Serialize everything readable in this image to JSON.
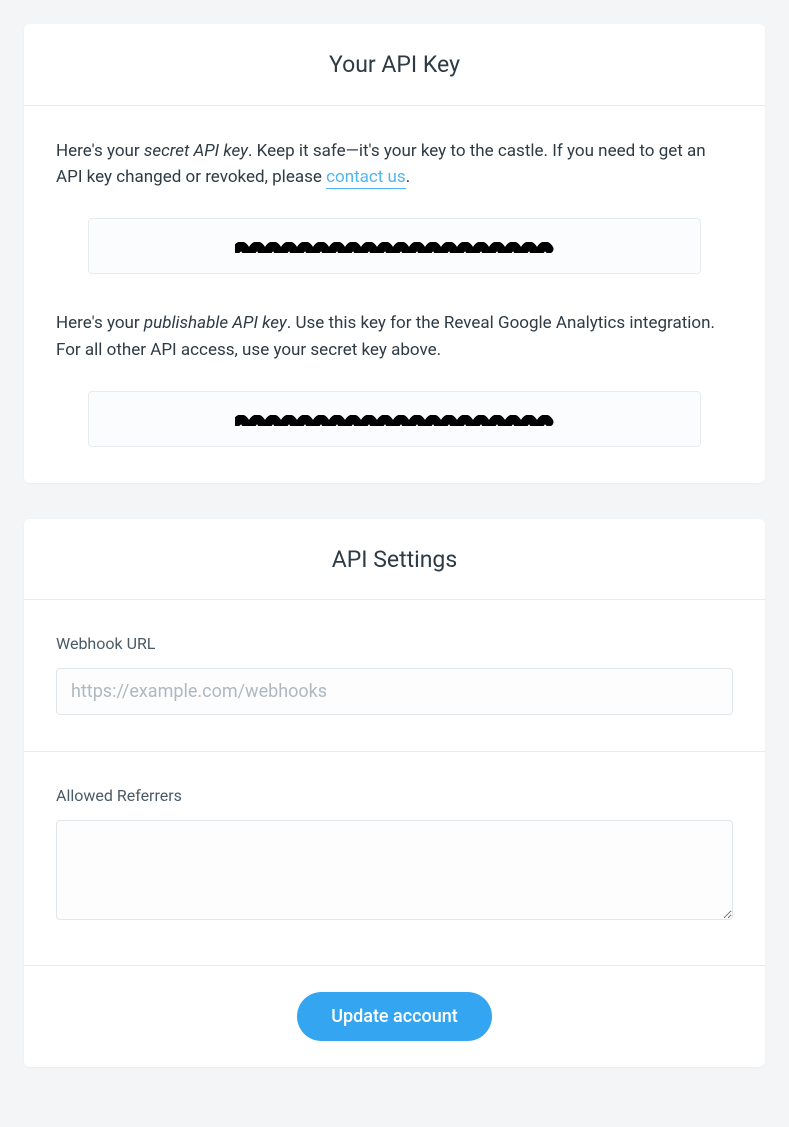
{
  "api_key_card": {
    "title": "Your API Key",
    "secret_prefix": "Here's your ",
    "secret_em": "secret API key",
    "secret_after": ". Keep it safe—it's your key to the castle. If you need to get an API key changed or revoked, please ",
    "contact_link": "contact us",
    "secret_end": ".",
    "publishable_prefix": "Here's your ",
    "publishable_em": "publishable API key",
    "publishable_after": ". Use this key for the Reveal Google Analytics integration. For all other API access, use your secret key above."
  },
  "settings_card": {
    "title": "API Settings",
    "webhook_label": "Webhook URL",
    "webhook_placeholder": "https://example.com/webhooks",
    "webhook_value": "",
    "referrers_label": "Allowed Referrers",
    "referrers_value": "",
    "submit_label": "Update account"
  },
  "colors": {
    "accent": "#34a6f1",
    "link": "#4fb6f2",
    "bg": "#f3f5f7"
  }
}
